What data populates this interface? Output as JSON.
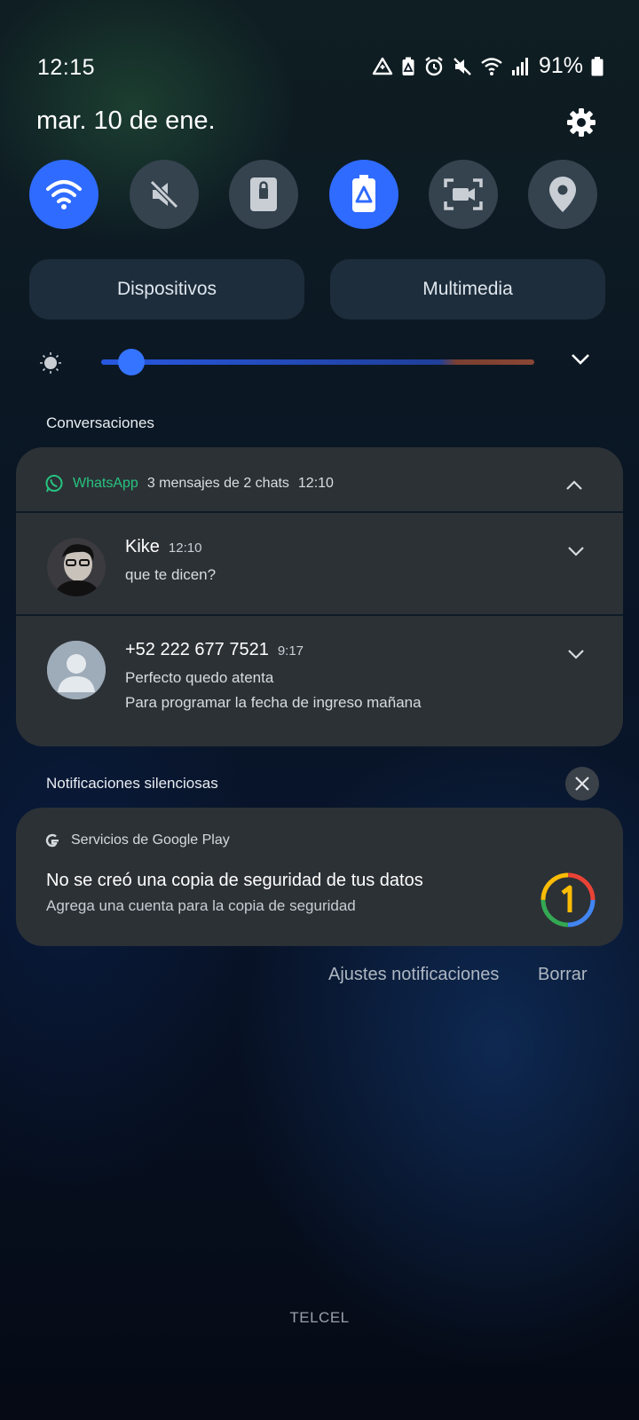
{
  "status_bar": {
    "time": "12:15",
    "battery_percent": "91%",
    "icons": [
      "data-saver-icon",
      "battery-saver-icon",
      "alarm-icon",
      "mute-icon",
      "wifi-icon",
      "signal-icon",
      "battery-icon"
    ]
  },
  "header": {
    "date": "mar. 10 de ene."
  },
  "quick_toggles": [
    {
      "name": "wifi",
      "icon": "wifi-icon",
      "on": true
    },
    {
      "name": "sound",
      "icon": "mute-icon",
      "on": false
    },
    {
      "name": "screen-lock",
      "icon": "lock-icon",
      "on": false
    },
    {
      "name": "power-saving",
      "icon": "battery-saver-icon",
      "on": true
    },
    {
      "name": "screen-capture",
      "icon": "screen-capture-icon",
      "on": false
    },
    {
      "name": "location",
      "icon": "location-icon",
      "on": false
    }
  ],
  "panel_buttons": {
    "devices": "Dispositivos",
    "media": "Multimedia"
  },
  "brightness": {
    "level": 0.07
  },
  "conversations": {
    "section_title": "Conversaciones",
    "group": {
      "app": "WhatsApp",
      "summary": "3 mensajes de 2 chats",
      "time": "12:10"
    },
    "items": [
      {
        "sender": "Kike",
        "time": "12:10",
        "lines": [
          "que te dicen?"
        ]
      },
      {
        "sender": "+52 222 677 7521",
        "time": "9:17",
        "lines": [
          "Perfecto quedo atenta",
          "Para programar la fecha de ingreso mañana"
        ]
      }
    ]
  },
  "silent": {
    "section_title": "Notificaciones silenciosas",
    "app": "Servicios de Google Play",
    "title": "No se creó una copia de seguridad de tus datos",
    "subtitle": "Agrega una cuenta para la copia de seguridad"
  },
  "actions": {
    "settings": "Ajustes notificaciones",
    "clear": "Borrar"
  },
  "carrier": "TELCEL",
  "colors": {
    "accent": "#2f6bff",
    "whatsapp": "#27c37f",
    "card": "#2c3136"
  }
}
